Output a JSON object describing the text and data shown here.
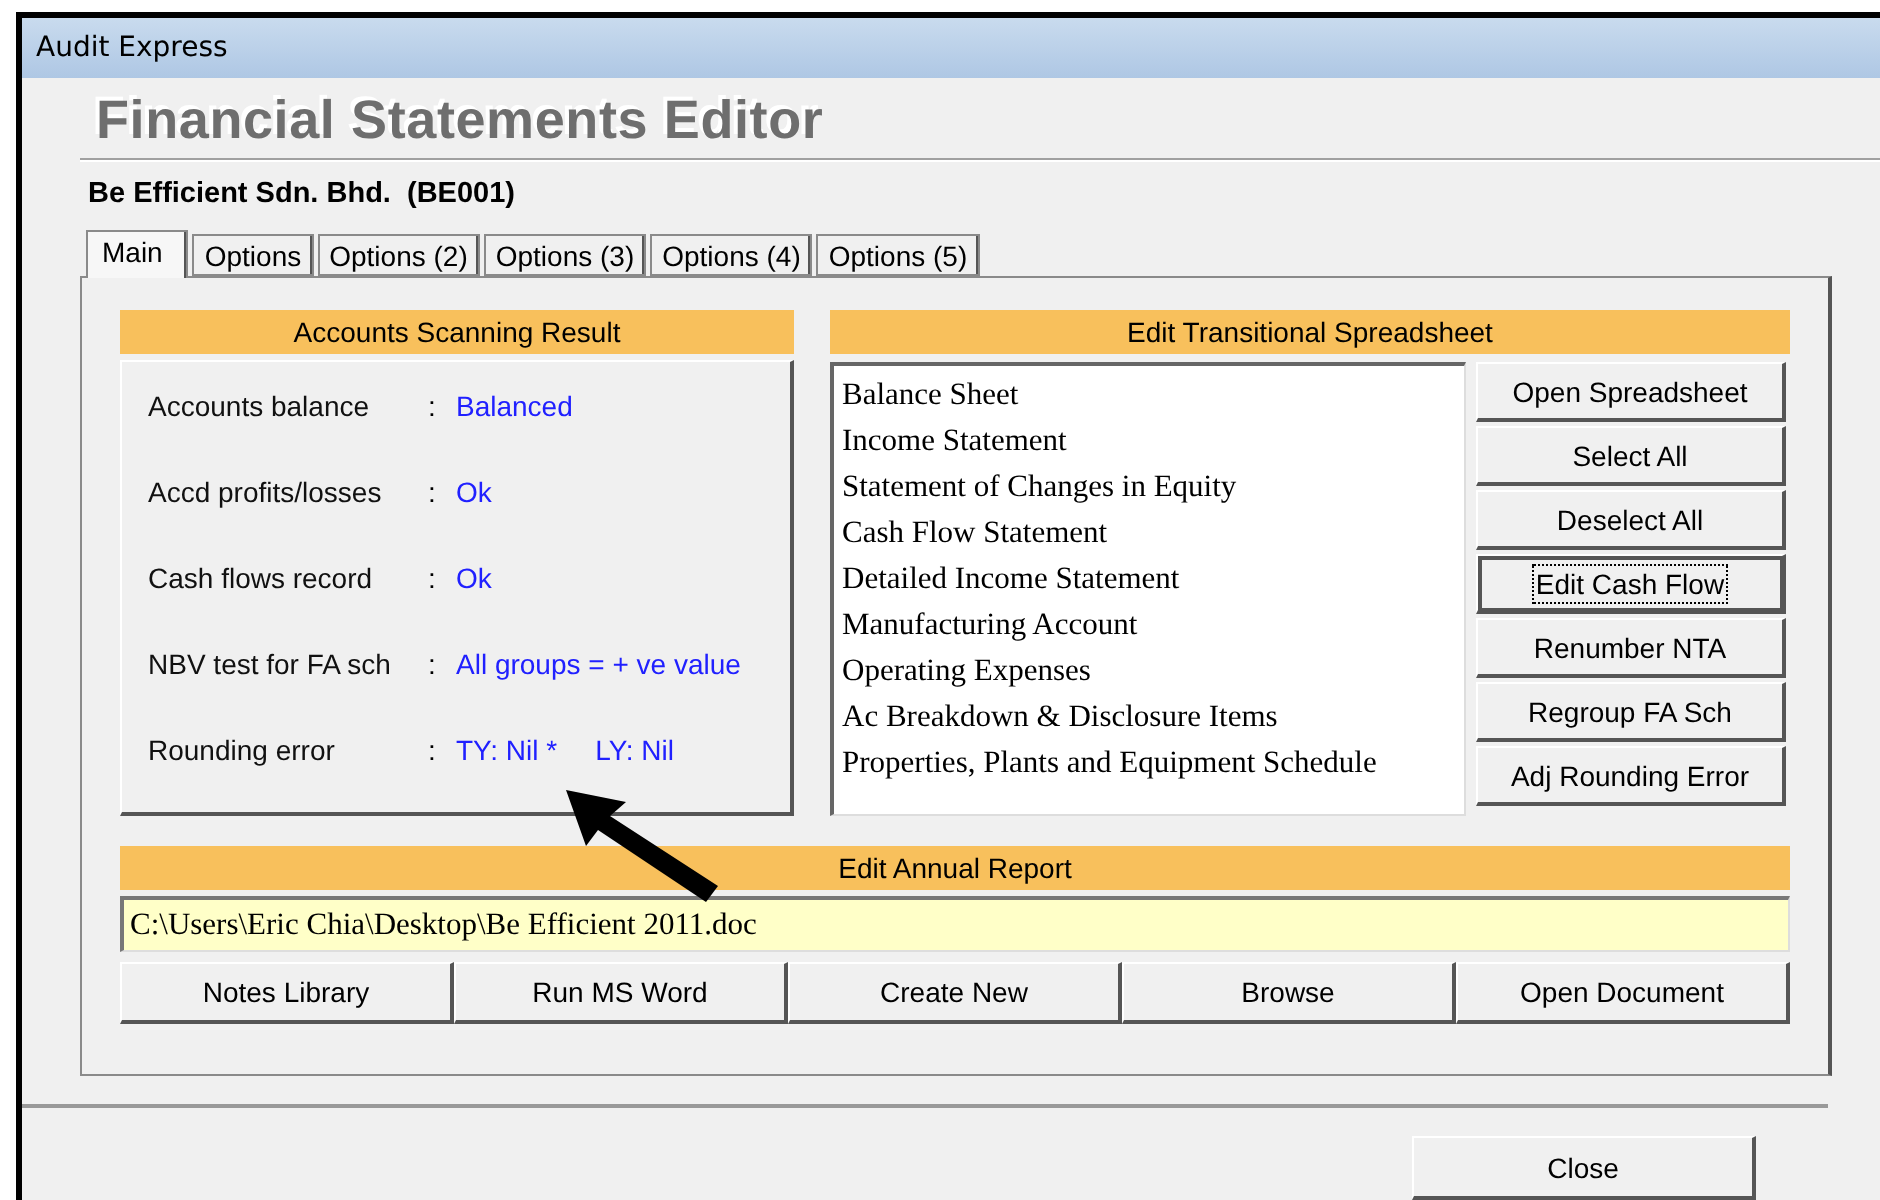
{
  "window": {
    "title": "Audit Express"
  },
  "heading": "Financial Statements Editor",
  "company": "Be Efficient Sdn. Bhd.  (BE001)",
  "tabs": [
    {
      "label": "Main",
      "selected": true
    },
    {
      "label": "Options",
      "selected": false
    },
    {
      "label": "Options (2)",
      "selected": false
    },
    {
      "label": "Options (3)",
      "selected": false
    },
    {
      "label": "Options (4)",
      "selected": false
    },
    {
      "label": "Options (5)",
      "selected": false
    }
  ],
  "scan": {
    "title": "Accounts Scanning Result",
    "rows": [
      {
        "label": "Accounts balance",
        "separator": ":",
        "values": [
          "Balanced"
        ]
      },
      {
        "label": "Accd profits/losses",
        "separator": ":",
        "values": [
          "Ok"
        ]
      },
      {
        "label": "Cash flows record",
        "separator": ":",
        "values": [
          "Ok"
        ]
      },
      {
        "label": "NBV test for FA sch",
        "separator": ":",
        "values": [
          "All groups = + ve value"
        ]
      },
      {
        "label": "Rounding error",
        "separator": ":",
        "values": [
          "TY: Nil *",
          "LY: Nil"
        ]
      }
    ]
  },
  "spreadsheet": {
    "title": "Edit Transitional Spreadsheet",
    "items": [
      "Balance Sheet",
      "Income Statement",
      "Statement of Changes in Equity",
      "Cash Flow Statement",
      "Detailed Income Statement",
      "Manufacturing Account",
      "Operating Expenses",
      "Ac Breakdown & Disclosure Items",
      "Properties, Plants and Equipment Schedule"
    ],
    "buttons": [
      {
        "label": "Open Spreadsheet",
        "focused": false
      },
      {
        "label": "Select All",
        "focused": false
      },
      {
        "label": "Deselect All",
        "focused": false
      },
      {
        "label": "Edit Cash Flow",
        "focused": true
      },
      {
        "label": "Renumber NTA",
        "focused": false
      },
      {
        "label": "Regroup FA Sch",
        "focused": false
      },
      {
        "label": "Adj Rounding Error",
        "focused": false
      }
    ]
  },
  "annual_report": {
    "title": "Edit Annual Report",
    "path": "C:\\Users\\Eric Chia\\Desktop\\Be Efficient 2011.doc",
    "buttons": [
      "Notes Library",
      "Run MS Word",
      "Create New",
      "Browse",
      "Open Document"
    ]
  },
  "close_button": "Close"
}
